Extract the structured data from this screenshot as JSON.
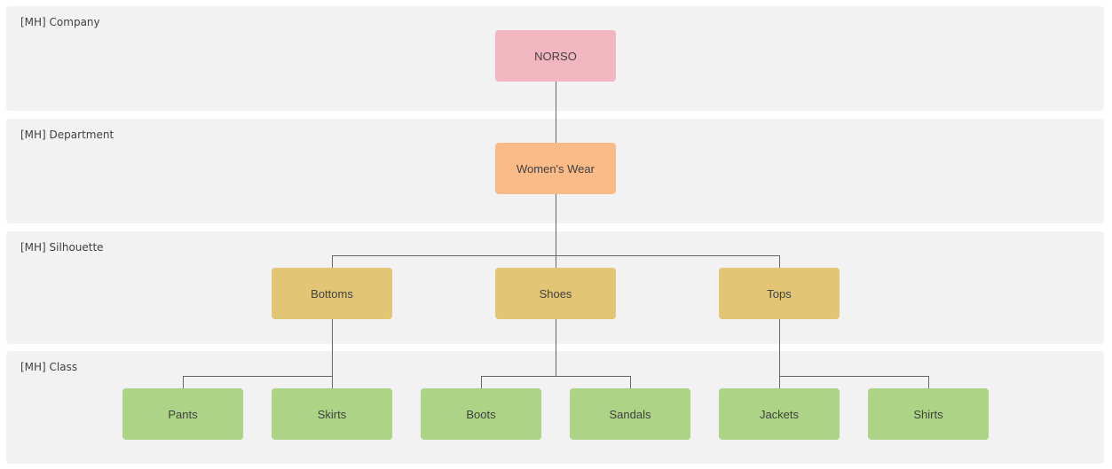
{
  "diagram": {
    "type": "org-hierarchy",
    "levels": [
      {
        "label": "[MH] Company"
      },
      {
        "label": "[MH] Department"
      },
      {
        "label": "[MH] Silhouette"
      },
      {
        "label": "[MH] Class"
      }
    ],
    "level_colors": [
      "#f2b6c1",
      "#fbbb88",
      "#e3c675",
      "#add486"
    ],
    "line_color": "#666666",
    "nodes": [
      {
        "id": "norso",
        "label": "NORSO",
        "level": 0,
        "parent": null
      },
      {
        "id": "womens-wear",
        "label": "Women's Wear",
        "level": 1,
        "parent": "norso"
      },
      {
        "id": "bottoms",
        "label": "Bottoms",
        "level": 2,
        "parent": "womens-wear"
      },
      {
        "id": "shoes",
        "label": "Shoes",
        "level": 2,
        "parent": "womens-wear"
      },
      {
        "id": "tops",
        "label": "Tops",
        "level": 2,
        "parent": "womens-wear"
      },
      {
        "id": "pants",
        "label": "Pants",
        "level": 3,
        "parent": "bottoms"
      },
      {
        "id": "skirts",
        "label": "Skirts",
        "level": 3,
        "parent": "bottoms"
      },
      {
        "id": "boots",
        "label": "Boots",
        "level": 3,
        "parent": "shoes"
      },
      {
        "id": "sandals",
        "label": "Sandals",
        "level": 3,
        "parent": "shoes"
      },
      {
        "id": "jackets",
        "label": "Jackets",
        "level": 3,
        "parent": "tops"
      },
      {
        "id": "shirts",
        "label": "Shirts",
        "level": 3,
        "parent": "tops"
      }
    ]
  }
}
